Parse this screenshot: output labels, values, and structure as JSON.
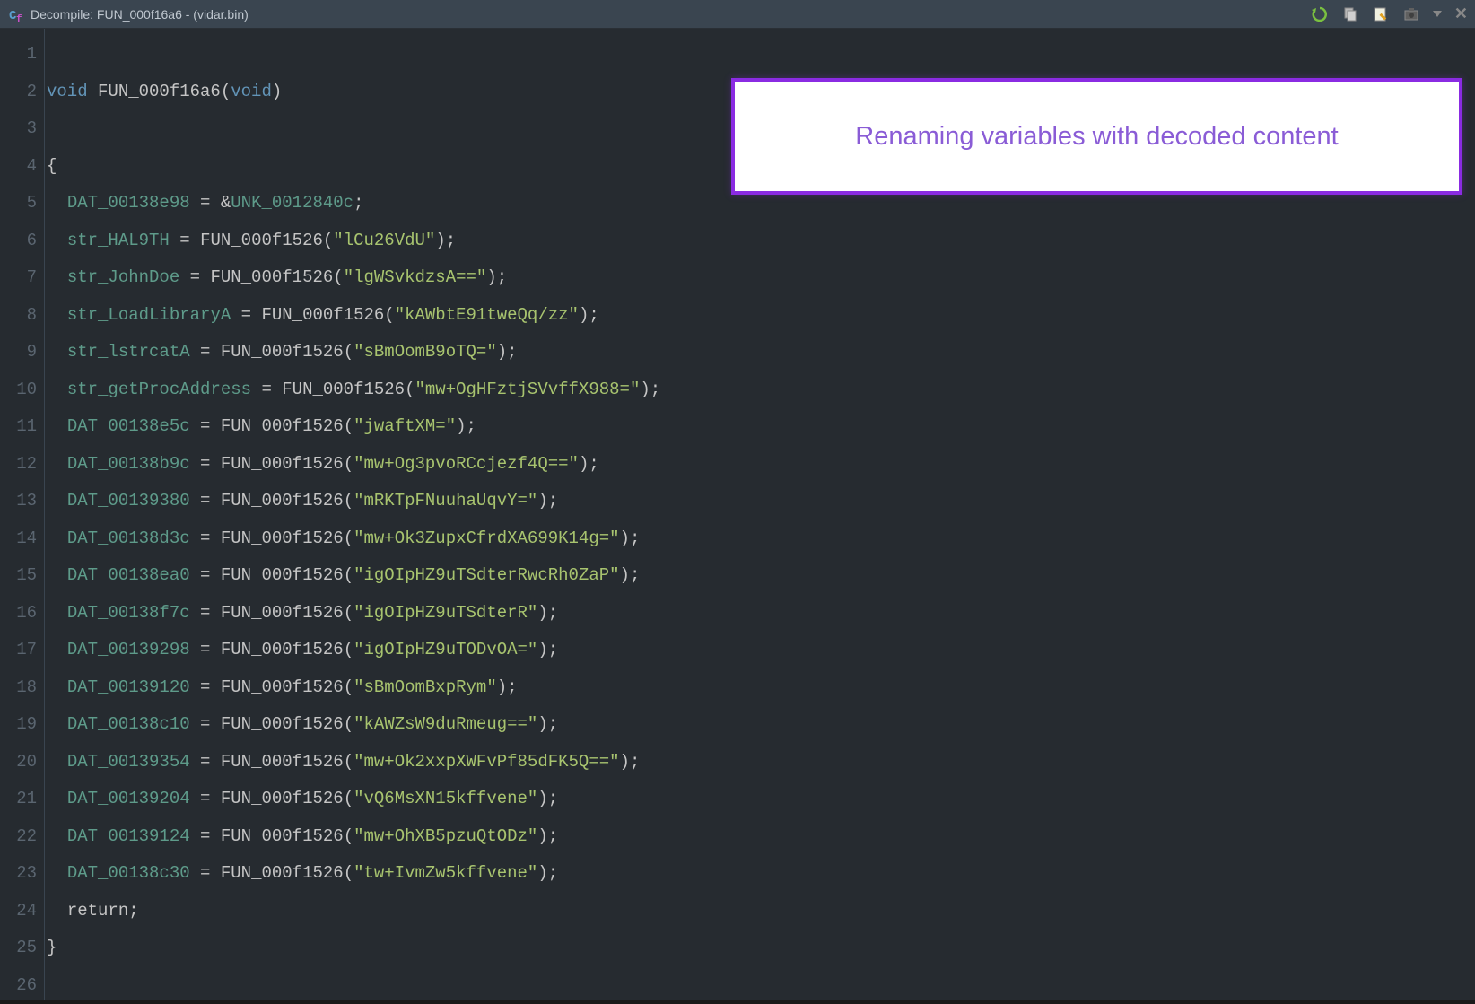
{
  "window": {
    "title": "Decompile: FUN_000f16a6  -  (vidar.bin)"
  },
  "callout": {
    "text": "Renaming variables with decoded content"
  },
  "toolbar": {
    "refresh": "refresh-icon",
    "copy": "copy-icon",
    "edit": "edit-icon",
    "snapshot": "snapshot-icon",
    "dropdown": "dropdown",
    "close": "close"
  },
  "code": {
    "lines": [
      {
        "num": 1,
        "tokens": []
      },
      {
        "num": 2,
        "tokens": [
          {
            "t": "type",
            "v": "void"
          },
          {
            "t": "sp",
            "v": " "
          },
          {
            "t": "func",
            "v": "FUN_000f16a6"
          },
          {
            "t": "punct",
            "v": "("
          },
          {
            "t": "type",
            "v": "void"
          },
          {
            "t": "punct",
            "v": ")"
          }
        ]
      },
      {
        "num": 3,
        "tokens": []
      },
      {
        "num": 4,
        "tokens": [
          {
            "t": "punct",
            "v": "{"
          }
        ]
      },
      {
        "num": 5,
        "tokens": [
          {
            "t": "sp",
            "v": "  "
          },
          {
            "t": "var",
            "v": "DAT_00138e98"
          },
          {
            "t": "sp",
            "v": " "
          },
          {
            "t": "punct",
            "v": "="
          },
          {
            "t": "sp",
            "v": " "
          },
          {
            "t": "amp",
            "v": "&"
          },
          {
            "t": "var",
            "v": "UNK_0012840c"
          },
          {
            "t": "punct",
            "v": ";"
          }
        ]
      },
      {
        "num": 6,
        "tokens": [
          {
            "t": "sp",
            "v": "  "
          },
          {
            "t": "var",
            "v": "str_HAL9TH"
          },
          {
            "t": "sp",
            "v": " "
          },
          {
            "t": "punct",
            "v": "="
          },
          {
            "t": "sp",
            "v": " "
          },
          {
            "t": "func",
            "v": "FUN_000f1526"
          },
          {
            "t": "punct",
            "v": "("
          },
          {
            "t": "string",
            "v": "\"lCu26VdU\""
          },
          {
            "t": "punct",
            "v": ");"
          }
        ]
      },
      {
        "num": 7,
        "tokens": [
          {
            "t": "sp",
            "v": "  "
          },
          {
            "t": "var",
            "v": "str_JohnDoe"
          },
          {
            "t": "sp",
            "v": " "
          },
          {
            "t": "punct",
            "v": "="
          },
          {
            "t": "sp",
            "v": " "
          },
          {
            "t": "func",
            "v": "FUN_000f1526"
          },
          {
            "t": "punct",
            "v": "("
          },
          {
            "t": "string",
            "v": "\"lgWSvkdzsA==\""
          },
          {
            "t": "punct",
            "v": ");"
          }
        ]
      },
      {
        "num": 8,
        "tokens": [
          {
            "t": "sp",
            "v": "  "
          },
          {
            "t": "var",
            "v": "str_LoadLibraryA"
          },
          {
            "t": "sp",
            "v": " "
          },
          {
            "t": "punct",
            "v": "="
          },
          {
            "t": "sp",
            "v": " "
          },
          {
            "t": "func",
            "v": "FUN_000f1526"
          },
          {
            "t": "punct",
            "v": "("
          },
          {
            "t": "string",
            "v": "\"kAWbtE91tweQq/zz\""
          },
          {
            "t": "punct",
            "v": ");"
          }
        ]
      },
      {
        "num": 9,
        "tokens": [
          {
            "t": "sp",
            "v": "  "
          },
          {
            "t": "var",
            "v": "str_lstrcatA"
          },
          {
            "t": "sp",
            "v": " "
          },
          {
            "t": "punct",
            "v": "="
          },
          {
            "t": "sp",
            "v": " "
          },
          {
            "t": "func",
            "v": "FUN_000f1526"
          },
          {
            "t": "punct",
            "v": "("
          },
          {
            "t": "string",
            "v": "\"sBmOomB9oTQ=\""
          },
          {
            "t": "punct",
            "v": ");"
          }
        ]
      },
      {
        "num": 10,
        "tokens": [
          {
            "t": "sp",
            "v": "  "
          },
          {
            "t": "var",
            "v": "str_getProcAddress"
          },
          {
            "t": "sp",
            "v": " "
          },
          {
            "t": "punct",
            "v": "="
          },
          {
            "t": "sp",
            "v": " "
          },
          {
            "t": "func",
            "v": "FUN_000f1526"
          },
          {
            "t": "punct",
            "v": "("
          },
          {
            "t": "string",
            "v": "\"mw+OgHFztjSVvffX988=\""
          },
          {
            "t": "punct",
            "v": ");"
          }
        ]
      },
      {
        "num": 11,
        "tokens": [
          {
            "t": "sp",
            "v": "  "
          },
          {
            "t": "var",
            "v": "DAT_00138e5c"
          },
          {
            "t": "sp",
            "v": " "
          },
          {
            "t": "punct",
            "v": "="
          },
          {
            "t": "sp",
            "v": " "
          },
          {
            "t": "func",
            "v": "FUN_000f1526"
          },
          {
            "t": "punct",
            "v": "("
          },
          {
            "t": "string",
            "v": "\"jwaftXM=\""
          },
          {
            "t": "punct",
            "v": ");"
          }
        ]
      },
      {
        "num": 12,
        "tokens": [
          {
            "t": "sp",
            "v": "  "
          },
          {
            "t": "var",
            "v": "DAT_00138b9c"
          },
          {
            "t": "sp",
            "v": " "
          },
          {
            "t": "punct",
            "v": "="
          },
          {
            "t": "sp",
            "v": " "
          },
          {
            "t": "func",
            "v": "FUN_000f1526"
          },
          {
            "t": "punct",
            "v": "("
          },
          {
            "t": "string",
            "v": "\"mw+Og3pvoRCcjezf4Q==\""
          },
          {
            "t": "punct",
            "v": ");"
          }
        ]
      },
      {
        "num": 13,
        "tokens": [
          {
            "t": "sp",
            "v": "  "
          },
          {
            "t": "var",
            "v": "DAT_00139380"
          },
          {
            "t": "sp",
            "v": " "
          },
          {
            "t": "punct",
            "v": "="
          },
          {
            "t": "sp",
            "v": " "
          },
          {
            "t": "func",
            "v": "FUN_000f1526"
          },
          {
            "t": "punct",
            "v": "("
          },
          {
            "t": "string",
            "v": "\"mRKTpFNuuhaUqvY=\""
          },
          {
            "t": "punct",
            "v": ");"
          }
        ]
      },
      {
        "num": 14,
        "tokens": [
          {
            "t": "sp",
            "v": "  "
          },
          {
            "t": "var",
            "v": "DAT_00138d3c"
          },
          {
            "t": "sp",
            "v": " "
          },
          {
            "t": "punct",
            "v": "="
          },
          {
            "t": "sp",
            "v": " "
          },
          {
            "t": "func",
            "v": "FUN_000f1526"
          },
          {
            "t": "punct",
            "v": "("
          },
          {
            "t": "string",
            "v": "\"mw+Ok3ZupxCfrdXA699K14g=\""
          },
          {
            "t": "punct",
            "v": ");"
          }
        ]
      },
      {
        "num": 15,
        "tokens": [
          {
            "t": "sp",
            "v": "  "
          },
          {
            "t": "var",
            "v": "DAT_00138ea0"
          },
          {
            "t": "sp",
            "v": " "
          },
          {
            "t": "punct",
            "v": "="
          },
          {
            "t": "sp",
            "v": " "
          },
          {
            "t": "func",
            "v": "FUN_000f1526"
          },
          {
            "t": "punct",
            "v": "("
          },
          {
            "t": "string",
            "v": "\"igOIpHZ9uTSdterRwcRh0ZaP\""
          },
          {
            "t": "punct",
            "v": ");"
          }
        ]
      },
      {
        "num": 16,
        "tokens": [
          {
            "t": "sp",
            "v": "  "
          },
          {
            "t": "var",
            "v": "DAT_00138f7c"
          },
          {
            "t": "sp",
            "v": " "
          },
          {
            "t": "punct",
            "v": "="
          },
          {
            "t": "sp",
            "v": " "
          },
          {
            "t": "func",
            "v": "FUN_000f1526"
          },
          {
            "t": "punct",
            "v": "("
          },
          {
            "t": "string",
            "v": "\"igOIpHZ9uTSdterR\""
          },
          {
            "t": "punct",
            "v": ");"
          }
        ]
      },
      {
        "num": 17,
        "tokens": [
          {
            "t": "sp",
            "v": "  "
          },
          {
            "t": "var",
            "v": "DAT_00139298"
          },
          {
            "t": "sp",
            "v": " "
          },
          {
            "t": "punct",
            "v": "="
          },
          {
            "t": "sp",
            "v": " "
          },
          {
            "t": "func",
            "v": "FUN_000f1526"
          },
          {
            "t": "punct",
            "v": "("
          },
          {
            "t": "string",
            "v": "\"igOIpHZ9uTODvOA=\""
          },
          {
            "t": "punct",
            "v": ");"
          }
        ]
      },
      {
        "num": 18,
        "tokens": [
          {
            "t": "sp",
            "v": "  "
          },
          {
            "t": "var",
            "v": "DAT_00139120"
          },
          {
            "t": "sp",
            "v": " "
          },
          {
            "t": "punct",
            "v": "="
          },
          {
            "t": "sp",
            "v": " "
          },
          {
            "t": "func",
            "v": "FUN_000f1526"
          },
          {
            "t": "punct",
            "v": "("
          },
          {
            "t": "string",
            "v": "\"sBmOomBxpRym\""
          },
          {
            "t": "punct",
            "v": ");"
          }
        ]
      },
      {
        "num": 19,
        "tokens": [
          {
            "t": "sp",
            "v": "  "
          },
          {
            "t": "var",
            "v": "DAT_00138c10"
          },
          {
            "t": "sp",
            "v": " "
          },
          {
            "t": "punct",
            "v": "="
          },
          {
            "t": "sp",
            "v": " "
          },
          {
            "t": "func",
            "v": "FUN_000f1526"
          },
          {
            "t": "punct",
            "v": "("
          },
          {
            "t": "string",
            "v": "\"kAWZsW9duRmeug==\""
          },
          {
            "t": "punct",
            "v": ");"
          }
        ]
      },
      {
        "num": 20,
        "tokens": [
          {
            "t": "sp",
            "v": "  "
          },
          {
            "t": "var",
            "v": "DAT_00139354"
          },
          {
            "t": "sp",
            "v": " "
          },
          {
            "t": "punct",
            "v": "="
          },
          {
            "t": "sp",
            "v": " "
          },
          {
            "t": "func",
            "v": "FUN_000f1526"
          },
          {
            "t": "punct",
            "v": "("
          },
          {
            "t": "string",
            "v": "\"mw+Ok2xxpXWFvPf85dFK5Q==\""
          },
          {
            "t": "punct",
            "v": ");"
          }
        ]
      },
      {
        "num": 21,
        "tokens": [
          {
            "t": "sp",
            "v": "  "
          },
          {
            "t": "var",
            "v": "DAT_00139204"
          },
          {
            "t": "sp",
            "v": " "
          },
          {
            "t": "punct",
            "v": "="
          },
          {
            "t": "sp",
            "v": " "
          },
          {
            "t": "func",
            "v": "FUN_000f1526"
          },
          {
            "t": "punct",
            "v": "("
          },
          {
            "t": "string",
            "v": "\"vQ6MsXN15kffvene\""
          },
          {
            "t": "punct",
            "v": ");"
          }
        ]
      },
      {
        "num": 22,
        "tokens": [
          {
            "t": "sp",
            "v": "  "
          },
          {
            "t": "var",
            "v": "DAT_00139124"
          },
          {
            "t": "sp",
            "v": " "
          },
          {
            "t": "punct",
            "v": "="
          },
          {
            "t": "sp",
            "v": " "
          },
          {
            "t": "func",
            "v": "FUN_000f1526"
          },
          {
            "t": "punct",
            "v": "("
          },
          {
            "t": "string",
            "v": "\"mw+OhXB5pzuQtODz\""
          },
          {
            "t": "punct",
            "v": ");"
          }
        ]
      },
      {
        "num": 23,
        "tokens": [
          {
            "t": "sp",
            "v": "  "
          },
          {
            "t": "var",
            "v": "DAT_00138c30"
          },
          {
            "t": "sp",
            "v": " "
          },
          {
            "t": "punct",
            "v": "="
          },
          {
            "t": "sp",
            "v": " "
          },
          {
            "t": "func",
            "v": "FUN_000f1526"
          },
          {
            "t": "punct",
            "v": "("
          },
          {
            "t": "string",
            "v": "\"tw+IvmZw5kffvene\""
          },
          {
            "t": "punct",
            "v": ");"
          }
        ]
      },
      {
        "num": 24,
        "tokens": [
          {
            "t": "sp",
            "v": "  "
          },
          {
            "t": "keyword",
            "v": "return"
          },
          {
            "t": "punct",
            "v": ";"
          }
        ]
      },
      {
        "num": 25,
        "tokens": [
          {
            "t": "punct",
            "v": "}"
          }
        ]
      },
      {
        "num": 26,
        "tokens": []
      }
    ]
  }
}
